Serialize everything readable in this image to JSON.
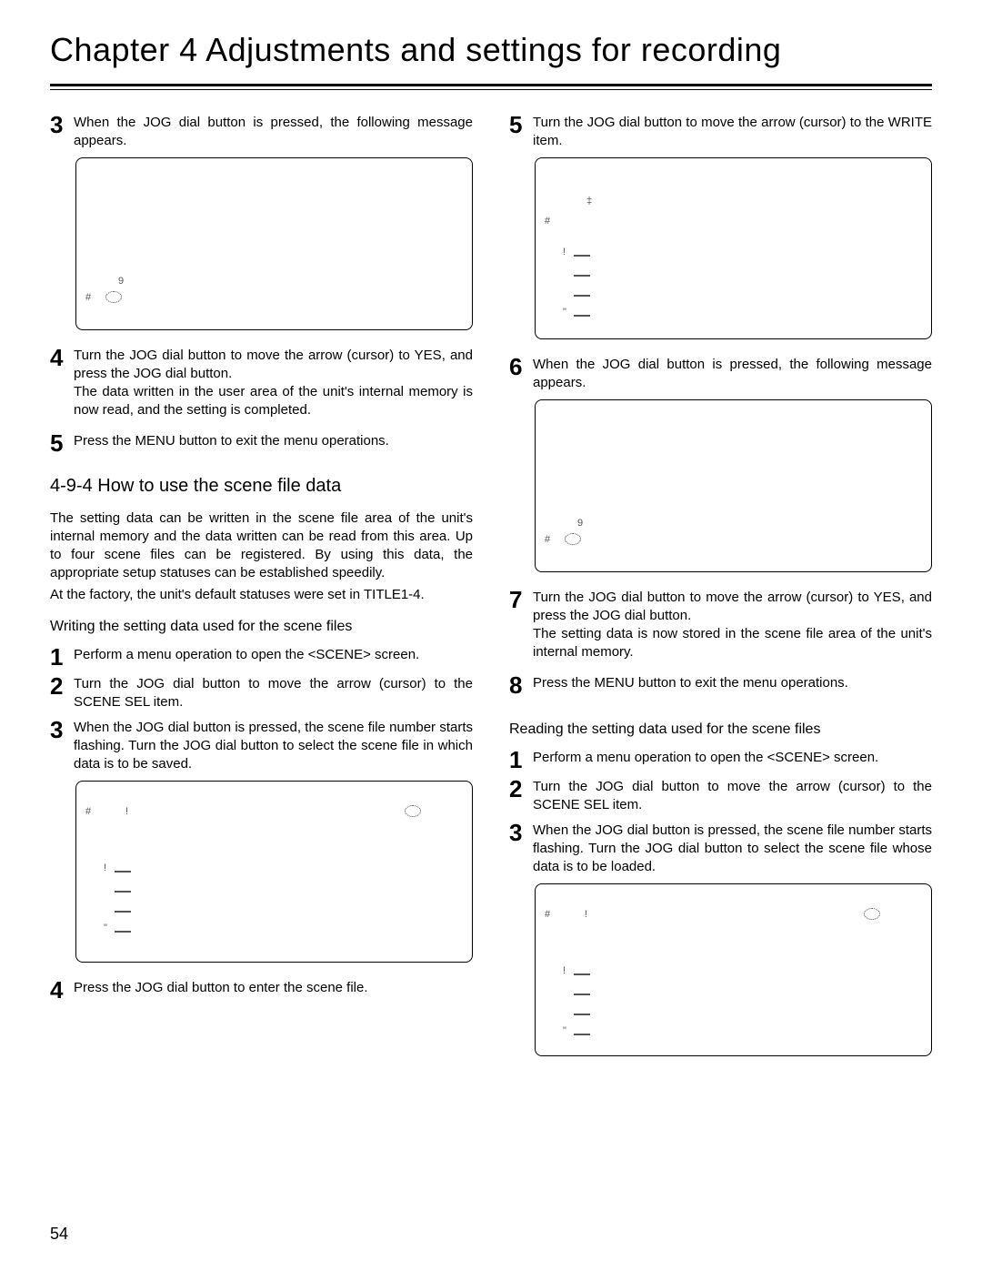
{
  "chapterTitle": "Chapter 4  Adjustments and settings for recording",
  "pageNumber": "54",
  "left": {
    "step3": "When the JOG dial button is pressed, the following message appears.",
    "panelA": {
      "nine": "9",
      "hash": "#"
    },
    "step4": "Turn the JOG dial button to move the arrow (cursor) to YES, and press the JOG dial button.\nThe data written in the user area of the unit's internal memory is now read, and the setting is completed.",
    "step5": "Press the MENU button to exit the menu operations.",
    "h2": "4-9-4 How to use the scene file data",
    "intro1": "The setting data can be written in the scene file area of the unit's internal memory and the data written can be read from this area.  Up to four scene files can be registered.  By using this data, the appropriate setup statuses can be established speedily.",
    "intro2": "At the factory, the unit's default statuses were set in TITLE1-4.",
    "subH_write": "Writing the setting data used for the scene files",
    "w1": "Perform a menu operation to open the <SCENE> screen.",
    "w2": "Turn the JOG dial button to move the arrow (cursor) to the SCENE SEL item.",
    "w3": "When the JOG dial button is pressed, the scene file number starts flashing.  Turn the JOG dial button to select the scene file in which data is to be saved.",
    "panelB": {
      "hash": "#",
      "exc1": "!",
      "exc2": "!",
      "quote": "\""
    },
    "w4": "Press the JOG dial button to enter the scene file."
  },
  "right": {
    "r5": "Turn the JOG dial button to move the arrow (cursor) to the WRITE item.",
    "panelC": {
      "hash": "#",
      "exc": "!",
      "quote": "\""
    },
    "r6": "When the JOG dial button is pressed, the following message appears.",
    "panelD": {
      "nine": "9",
      "hash": "#"
    },
    "r7": "Turn the JOG dial button to move the arrow (cursor) to YES, and press the JOG dial button.\nThe setting data is now stored in the scene file area of the unit's internal memory.",
    "r8": "Press the MENU button to exit the menu operations.",
    "subH_read": "Reading the setting data used for the scene files",
    "rd1": "Perform a menu operation to open the <SCENE> screen.",
    "rd2": "Turn the JOG dial button to move the arrow (cursor) to the SCENE SEL item.",
    "rd3": "When the JOG dial button is pressed, the scene file number starts flashing.  Turn the JOG dial button to select the scene file whose data is to be loaded.",
    "panelE": {
      "hash": "#",
      "exc1": "!",
      "exc2": "!",
      "quote": "\""
    }
  }
}
